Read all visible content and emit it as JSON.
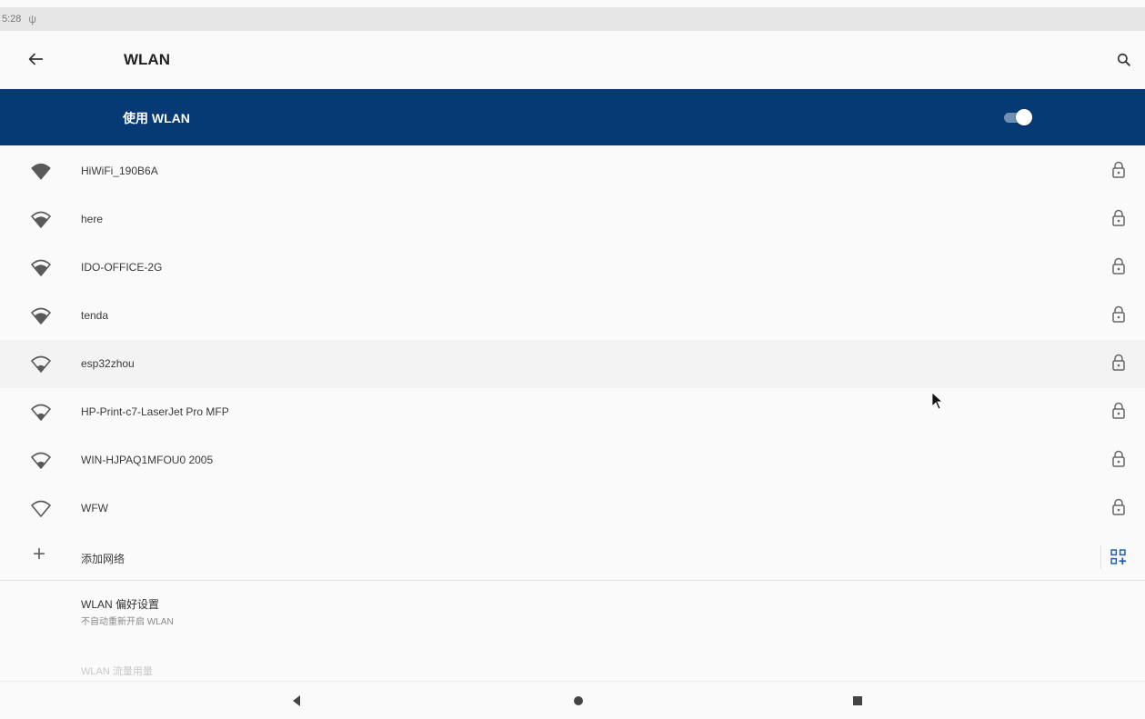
{
  "status_bar": {
    "time": "5:28",
    "usb_icon": "usb-icon"
  },
  "app_bar": {
    "title": "WLAN",
    "back_icon": "arrow-back-icon",
    "search_icon": "search-icon"
  },
  "master_switch": {
    "label": "使用 WLAN",
    "enabled": true,
    "accent_color": "#053a74"
  },
  "networks": [
    {
      "ssid": "HiWiFi_190B6A",
      "secured": true,
      "signal": 4
    },
    {
      "ssid": "here",
      "secured": true,
      "signal": 3
    },
    {
      "ssid": "IDO-OFFICE-2G",
      "secured": true,
      "signal": 3
    },
    {
      "ssid": "tenda",
      "secured": true,
      "signal": 3
    },
    {
      "ssid": "esp32zhou",
      "secured": true,
      "signal": 2
    },
    {
      "ssid": "HP-Print-c7-LaserJet Pro MFP",
      "secured": true,
      "signal": 2
    },
    {
      "ssid": "WIN-HJPAQ1MFOU0 2005",
      "secured": true,
      "signal": 2
    },
    {
      "ssid": "WFW",
      "secured": true,
      "signal": 1
    }
  ],
  "add_network": {
    "label": "添加网络",
    "qr_icon": "qr-code-scan-icon"
  },
  "preferences": {
    "title": "WLAN 偏好设置",
    "subtitle": "不自动重新开启 WLAN"
  },
  "data_usage": {
    "label": "WLAN 流量用量"
  },
  "nav_bar": {
    "back_icon": "nav-back-icon",
    "home_icon": "nav-home-icon",
    "recents_icon": "nav-recents-icon"
  }
}
